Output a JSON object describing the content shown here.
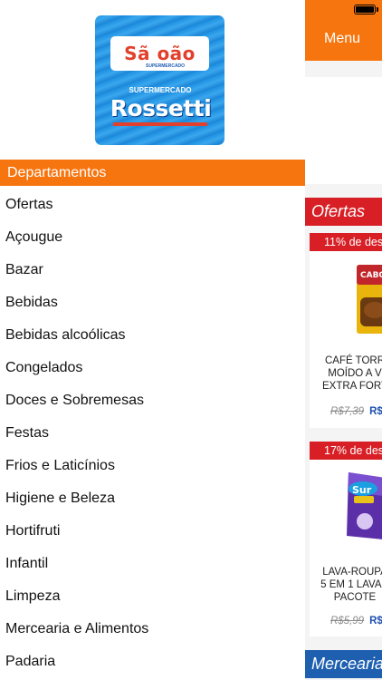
{
  "colors": {
    "accent_orange": "#f7750f",
    "offer_red": "#d81f26",
    "section_blue": "#1e5fb0",
    "price_blue": "#1e4fb0",
    "logo_blue": "#1d8fe0",
    "logo_red": "#e2402d"
  },
  "logo": {
    "top_text": "Sã  oão",
    "top_sub": "SUPERMERCADO",
    "mid_text": "SUPERMERCADO",
    "main_text": "Rossetti",
    "cart_icon": "cart-icon"
  },
  "drawer": {
    "header": "Departamentos",
    "items": [
      "Ofertas",
      "Açougue",
      "Bazar",
      "Bebidas",
      "Bebidas alcoólicas",
      "Congelados",
      "Doces e Sobremesas",
      "Festas",
      "Frios e Laticínios",
      "Higiene e Beleza",
      "Hortifruti",
      "Infantil",
      "Limpeza",
      "Mercearia e Alimentos",
      "Padaria"
    ]
  },
  "main": {
    "top_bar": {
      "menu_label": "Menu",
      "battery_icon": "battery-icon"
    },
    "sections": {
      "ofertas": "Ofertas",
      "mercearia": "Mercearia"
    },
    "products": [
      {
        "discount": "11% de des",
        "name_lines": [
          "CAFÉ TORR",
          "MOÍDO A V",
          "EXTRA FORT"
        ],
        "old_price": "R$7,39",
        "new_price": "R$"
      },
      {
        "discount": "17% de des",
        "name_lines": [
          "LAVA-ROUPA",
          "5 EM 1 LAVAN",
          "PACOTE"
        ],
        "old_price": "R$5,99",
        "new_price": "R$"
      }
    ]
  }
}
